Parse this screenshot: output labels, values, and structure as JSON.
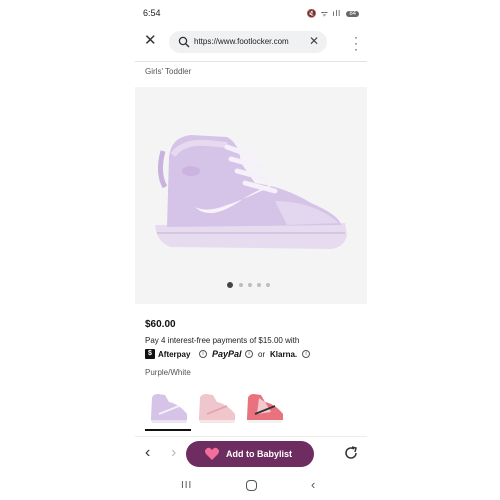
{
  "status_bar": {
    "time": "6:54",
    "icons": "🔇 ᯤ ıll",
    "battery": "84"
  },
  "browser": {
    "url": "https://www.footlocker.com",
    "close_icon": "close-icon",
    "menu_icon": "more-vert-icon"
  },
  "product": {
    "category": "Girls' Toddler",
    "price": "$60.00",
    "installments": "Pay 4 interest-free payments of $15.00 with",
    "payment_providers": {
      "afterpay": "Afterpay",
      "afterpay_badge": "$",
      "paypal": "PayPal",
      "or": "or",
      "klarna": "Klarna."
    },
    "color": "Purple/White",
    "image_dots": {
      "count": 5,
      "active_index": 0
    },
    "swatches": [
      {
        "name": "purple-white",
        "selected": true,
        "color": "#d6c3e8"
      },
      {
        "name": "pink",
        "selected": false,
        "color": "#f0c6cd"
      },
      {
        "name": "red-pink",
        "selected": false,
        "color": "#e8737f"
      }
    ]
  },
  "toolbar": {
    "babylist_label": "Add to Babylist"
  },
  "colors": {
    "babylist_purple": "#6e2d60",
    "shoe_lavender": "#d6c3e8",
    "heart_pink": "#f36e9a"
  }
}
